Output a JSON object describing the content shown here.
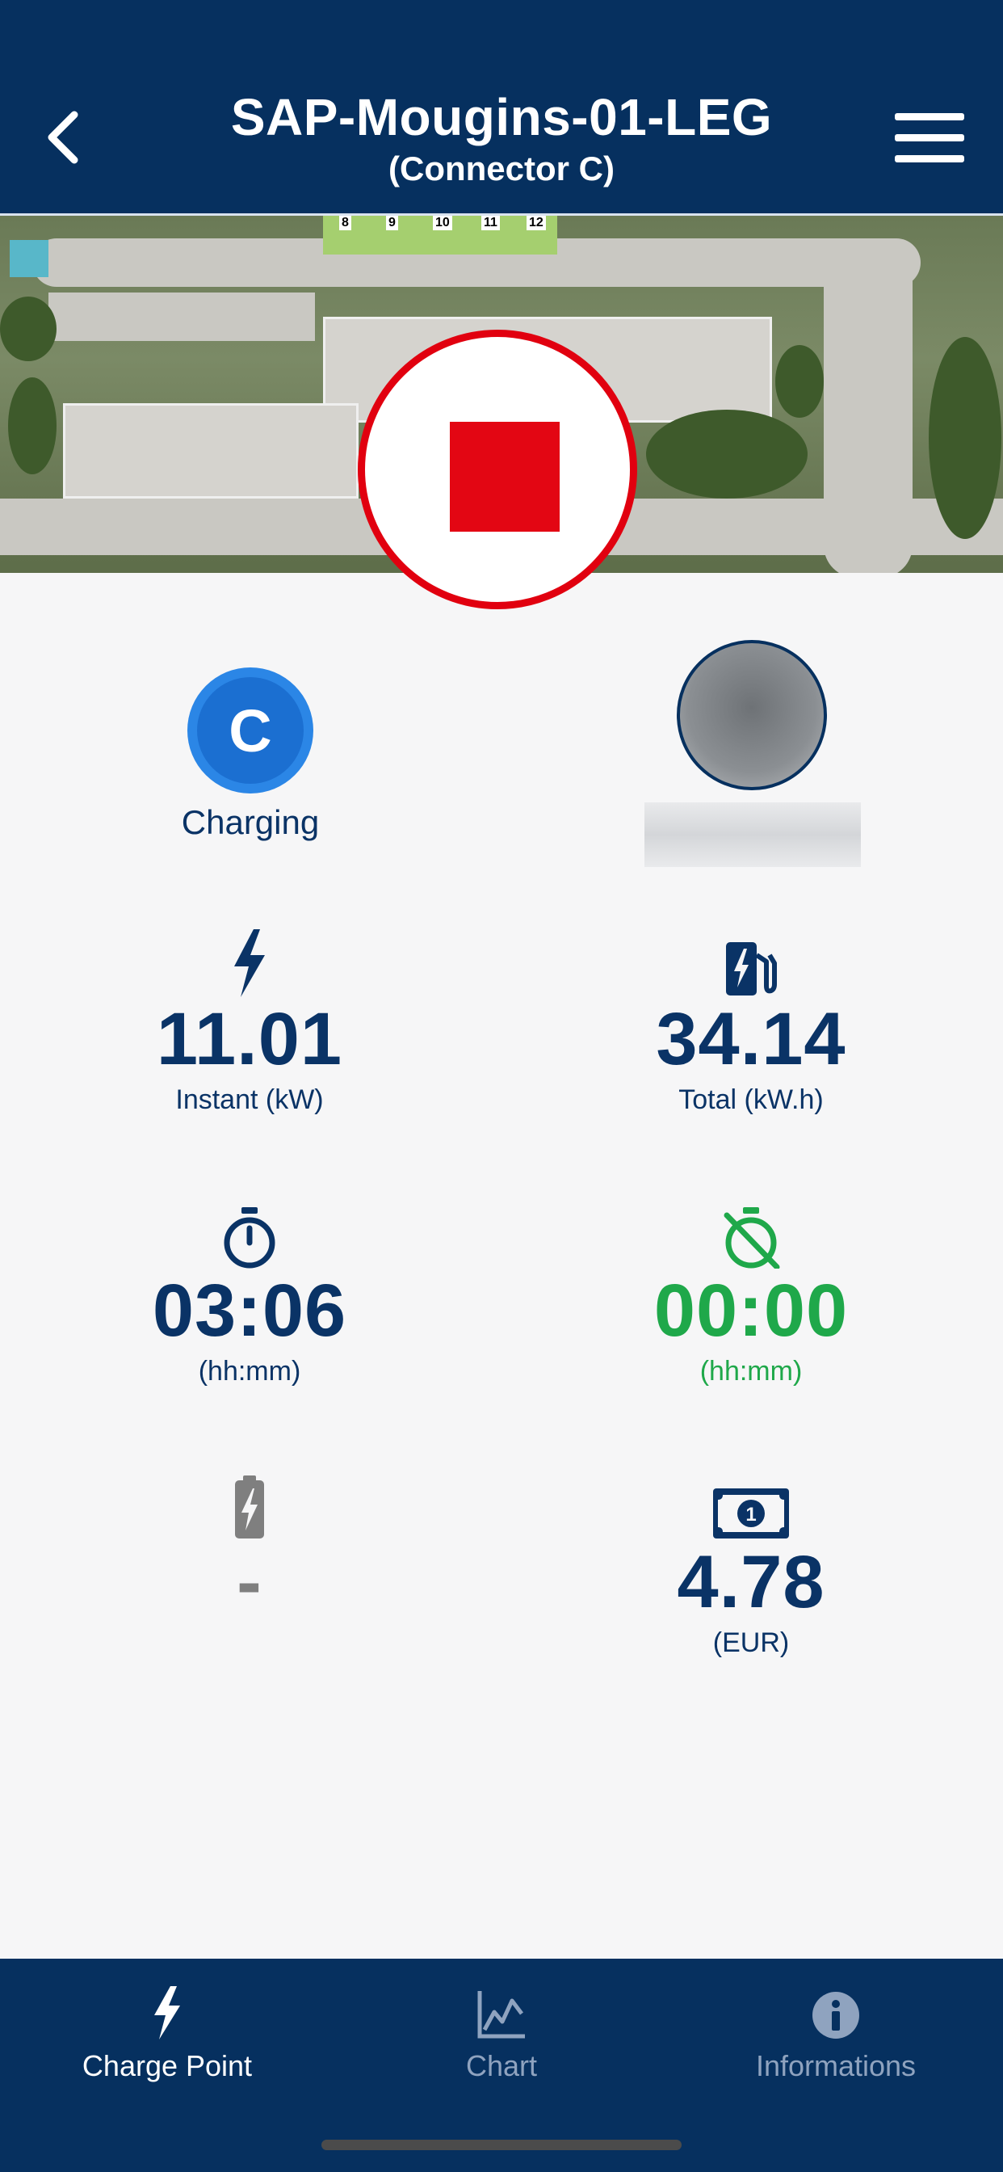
{
  "header": {
    "title": "SAP-Mougins-01-LEG",
    "subtitle": "(Connector C)"
  },
  "map": {
    "parking_labels": [
      "8",
      "9",
      "10",
      "11",
      "12"
    ]
  },
  "connector": {
    "letter": "C",
    "status": "Charging"
  },
  "metrics": {
    "instant": {
      "value": "11.01",
      "unit": "Instant (kW)",
      "icon": "bolt-icon"
    },
    "total": {
      "value": "34.14",
      "unit": "Total (kW.h)",
      "icon": "ev-station-icon"
    },
    "duration": {
      "value": "03:06",
      "unit": "(hh:mm)",
      "icon": "stopwatch-icon"
    },
    "idle": {
      "value": "00:00",
      "unit": "(hh:mm)",
      "icon": "stopwatch-off-icon"
    },
    "battery": {
      "value": "-",
      "icon": "battery-charging-icon"
    },
    "cost": {
      "value": "4.78",
      "unit": "(EUR)",
      "icon": "banknote-icon"
    }
  },
  "tabs": [
    {
      "label": "Charge Point",
      "icon": "bolt-icon",
      "active": true
    },
    {
      "label": "Chart",
      "icon": "chart-icon",
      "active": false
    },
    {
      "label": "Informations",
      "icon": "info-icon",
      "active": false
    }
  ],
  "colors": {
    "primary": "#06305f",
    "stop": "#e30613",
    "connector": "#1b6fd1",
    "green": "#1fa84a",
    "background": "#f6f6f7"
  }
}
